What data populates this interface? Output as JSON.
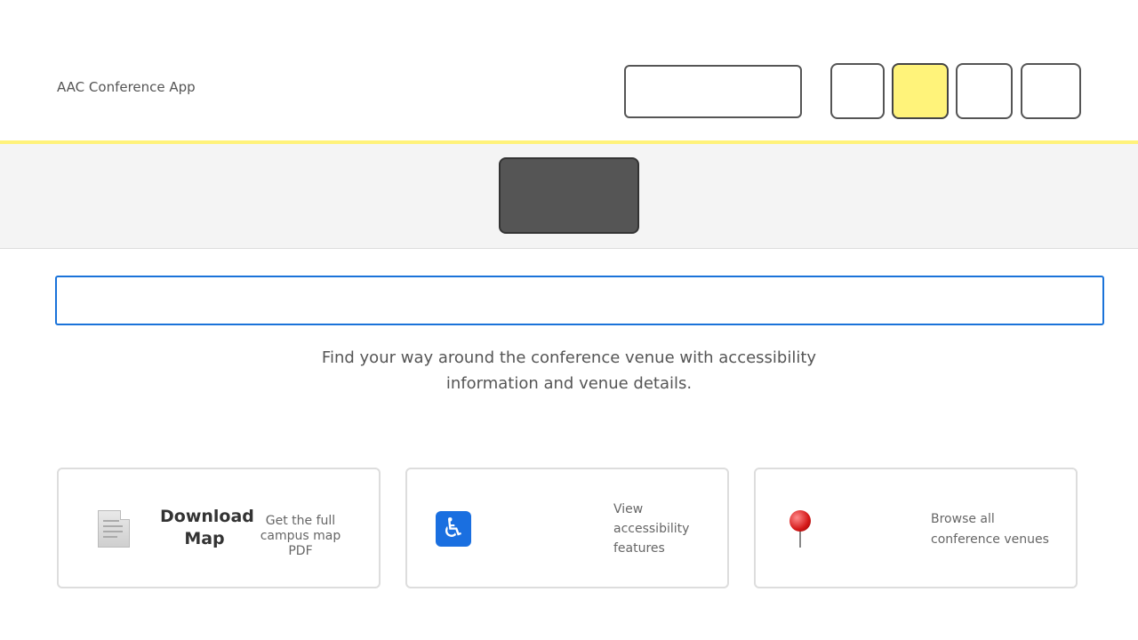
{
  "header": {
    "app_title": "AAC Conference App"
  },
  "search": {
    "value": "",
    "placeholder": ""
  },
  "intro": {
    "text": "Find your way around the conference venue with accessibility information and venue details."
  },
  "cards": [
    {
      "icon": "document-icon",
      "title": "Download Map",
      "description": "Get the full campus map PDF"
    },
    {
      "icon": "wheelchair-icon",
      "title": "",
      "description": "View accessibility features"
    },
    {
      "icon": "pushpin-icon",
      "title": "",
      "description": "Browse all conference venues"
    }
  ],
  "colors": {
    "accent_yellow": "#fff27a",
    "dark_button": "#555555",
    "focus_blue": "#1a73d9"
  }
}
